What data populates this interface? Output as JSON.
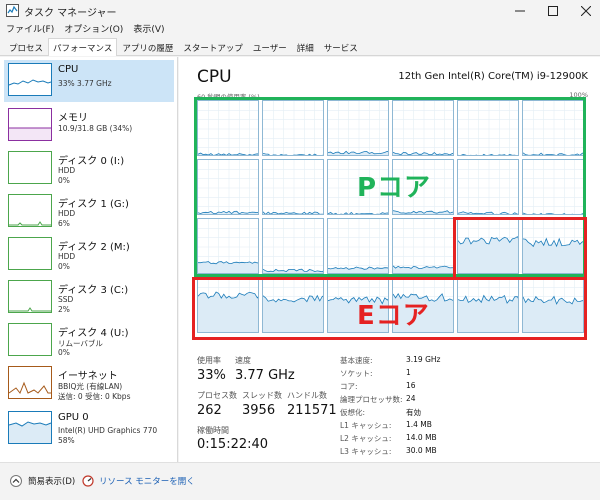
{
  "window": {
    "title": "タスク マネージャー"
  },
  "menu": [
    "ファイル(F)",
    "オプション(O)",
    "表示(V)"
  ],
  "tabs": [
    "プロセス",
    "パフォーマンス",
    "アプリの履歴",
    "スタートアップ",
    "ユーザー",
    "詳細",
    "サービス"
  ],
  "sidebar": [
    {
      "title": "CPU",
      "lines": [
        "33% 3.77 GHz"
      ],
      "color": "#1a7bb9",
      "selected": true
    },
    {
      "title": "メモリ",
      "lines": [
        "10.9/31.8 GB (34%)"
      ],
      "color": "#8b2fa0"
    },
    {
      "title": "ディスク 0 (I:)",
      "lines": [
        "HDD",
        "0%"
      ],
      "color": "#4ca64c"
    },
    {
      "title": "ディスク 1 (G:)",
      "lines": [
        "HDD",
        "6%"
      ],
      "color": "#4ca64c"
    },
    {
      "title": "ディスク 2 (M:)",
      "lines": [
        "HDD",
        "0%"
      ],
      "color": "#4ca64c"
    },
    {
      "title": "ディスク 3 (C:)",
      "lines": [
        "SSD",
        "2%"
      ],
      "color": "#4ca64c"
    },
    {
      "title": "ディスク 4 (U:)",
      "lines": [
        "リムーバブル",
        "0%"
      ],
      "color": "#4ca64c"
    },
    {
      "title": "イーサネット",
      "lines": [
        "BBIQ光 (有線LAN)",
        "送信: 0 受信: 0 Kbps"
      ],
      "color": "#a65a1a"
    },
    {
      "title": "GPU 0",
      "lines": [
        "Intel(R) UHD Graphics 770",
        "58%"
      ],
      "color": "#1a7bb9"
    }
  ],
  "main": {
    "title": "CPU",
    "model": "12th Gen Intel(R) Core(TM) i9-12900K",
    "util_label": "60 秒間の使用率 (%)",
    "util_max": "100%"
  },
  "annotations": {
    "p_core": "Pコア",
    "e_core": "Eコア"
  },
  "core_levels": [
    0.05,
    0.04,
    0.08,
    0.06,
    0.03,
    0.05,
    0.06,
    0.05,
    0.04,
    0.07,
    0.05,
    0.03,
    0.22,
    0.08,
    0.12,
    0.14,
    0.62,
    0.58,
    0.68,
    0.62,
    0.6,
    0.65,
    0.62,
    0.6
  ],
  "stats": {
    "usage_label": "使用率",
    "usage_value": "33%",
    "speed_label": "速度",
    "speed_value": "3.77 GHz",
    "processes_label": "プロセス数",
    "processes_value": "262",
    "threads_label": "スレッド数",
    "threads_value": "3956",
    "handles_label": "ハンドル数",
    "handles_value": "211571",
    "uptime_label": "稼働時間",
    "uptime_value": "0:15:22:40"
  },
  "specs": [
    {
      "label": "基本速度:",
      "value": "3.19 GHz"
    },
    {
      "label": "ソケット:",
      "value": "1"
    },
    {
      "label": "コア:",
      "value": "16"
    },
    {
      "label": "論理プロセッサ数:",
      "value": "24"
    },
    {
      "label": "仮想化:",
      "value": "有効"
    },
    {
      "label": "L1 キャッシュ:",
      "value": "1.4 MB"
    },
    {
      "label": "L2 キャッシュ:",
      "value": "14.0 MB"
    },
    {
      "label": "L3 キャッシュ:",
      "value": "30.0 MB"
    }
  ],
  "footer": {
    "brief": "簡易表示(D)",
    "monitor": "リソース モニターを開く"
  }
}
